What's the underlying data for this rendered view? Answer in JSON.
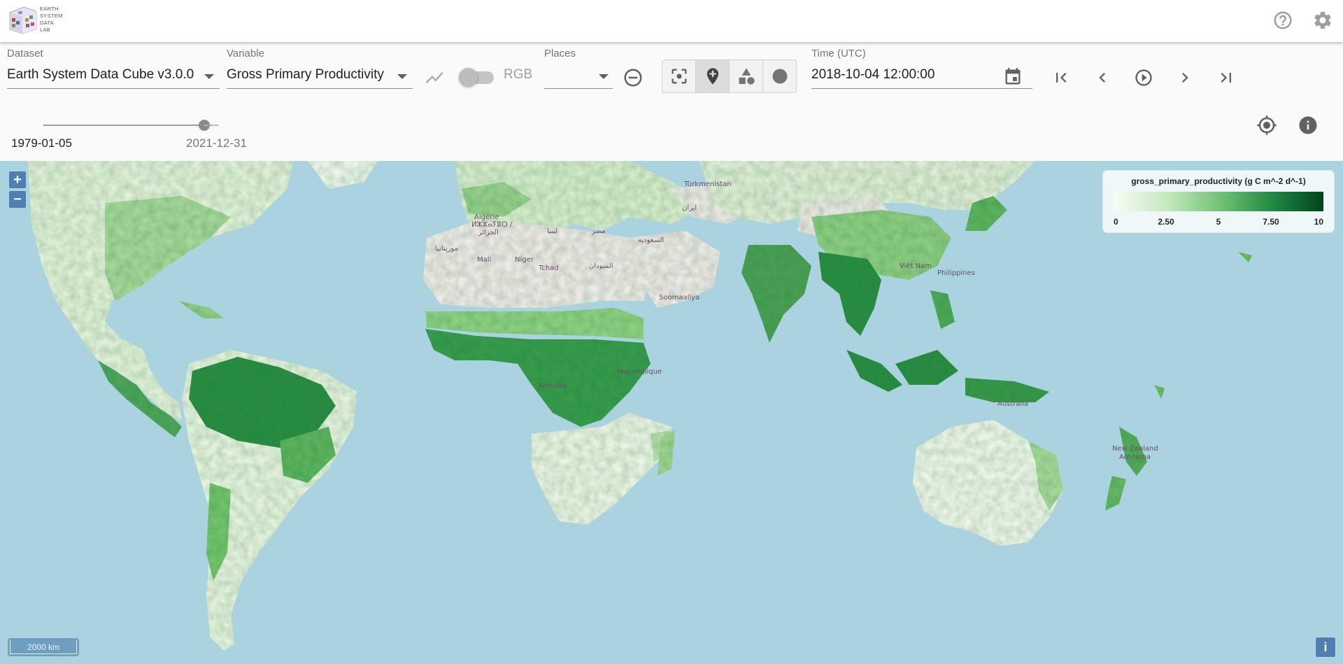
{
  "app": {
    "logo_lines": [
      "EARTH",
      "SYSTEM",
      "DATA",
      "LAB"
    ]
  },
  "controls": {
    "dataset": {
      "label": "Dataset",
      "value": "Earth System Data Cube v3.0.0"
    },
    "variable": {
      "label": "Variable",
      "value": "Gross Primary Productivity"
    },
    "rgb": {
      "label": "RGB",
      "enabled": false
    },
    "places": {
      "label": "Places",
      "value": ""
    },
    "time": {
      "label": "Time (UTC)",
      "value": "2018-10-04 12:00:00"
    },
    "time_range": {
      "min": "1979-01-05",
      "max": "2021-12-31",
      "position": 0.92
    }
  },
  "map": {
    "zoom_in": "+",
    "zoom_out": "−",
    "scale_label": "2000 km",
    "attribution": "i",
    "labels": [
      {
        "text": "Algérie"
      },
      {
        "text": "ⵍⵣⵣⴰⵢⴻⵔ /"
      },
      {
        "text": "الجزائر"
      },
      {
        "text": "ليبيا"
      },
      {
        "text": "مصر"
      },
      {
        "text": "السعودية"
      },
      {
        "text": "ایران"
      },
      {
        "text": "Türkmenistan"
      },
      {
        "text": "موريتانيا"
      },
      {
        "text": "Mali"
      },
      {
        "text": "Niger"
      },
      {
        "text": "Tchad"
      },
      {
        "text": "السودان"
      },
      {
        "text": "Soomaaliya"
      },
      {
        "text": "Philippines"
      },
      {
        "text": "Việt Nam"
      },
      {
        "text": "Moçambique"
      },
      {
        "text": "Namibia"
      },
      {
        "text": "Australia"
      },
      {
        "text": "New Zealand"
      },
      {
        "text": "Aotearoa"
      }
    ]
  },
  "legend": {
    "title": "gross_primary_productivity (g C m^-2 d^-1)",
    "ticks": [
      "0",
      "2.50",
      "5",
      "7.50",
      "10"
    ],
    "colors": [
      "#f7fcf5",
      "#c7e9c0",
      "#74c476",
      "#238b45",
      "#00441b"
    ]
  },
  "icons": {
    "help": "help-icon",
    "settings": "gear-icon",
    "timeseries": "chart-line-icon",
    "remove_place": "minus-circle-icon",
    "select": "focus-select-icon",
    "point": "add-location-icon",
    "polygon": "shapes-icon",
    "circle": "circle-icon",
    "calendar": "calendar-icon",
    "first": "skip-first-icon",
    "prev": "chevron-left-icon",
    "play": "play-circle-icon",
    "next": "chevron-right-icon",
    "last": "skip-last-icon",
    "locate": "gps-icon",
    "info": "info-icon"
  }
}
